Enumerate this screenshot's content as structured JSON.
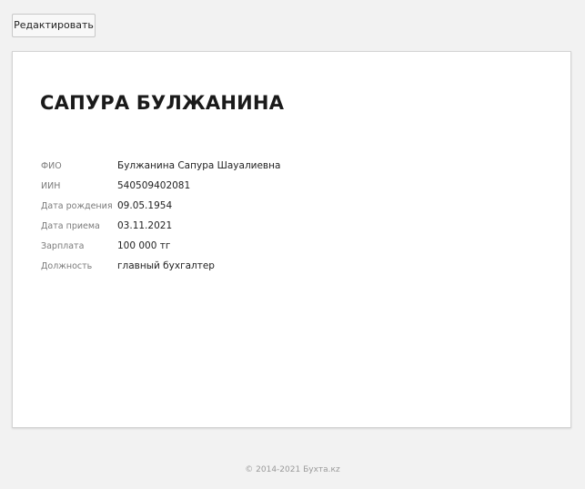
{
  "toolbar": {
    "edit_label": "Редактировать"
  },
  "employee": {
    "title": "САПУРА БУЛЖАНИНА",
    "fields": [
      {
        "label": "ФИО",
        "value": "Булжанина Сапура Шауалиевна"
      },
      {
        "label": "ИИН",
        "value": "540509402081"
      },
      {
        "label": "Дата рождения",
        "value": "09.05.1954"
      },
      {
        "label": "Дата приема",
        "value": "03.11.2021"
      },
      {
        "label": "Зарплата",
        "value": "100 000 тг"
      },
      {
        "label": "Должность",
        "value": "главный бухгалтер"
      }
    ]
  },
  "footer": {
    "text": "© 2014-2021 Бухта.кz"
  }
}
